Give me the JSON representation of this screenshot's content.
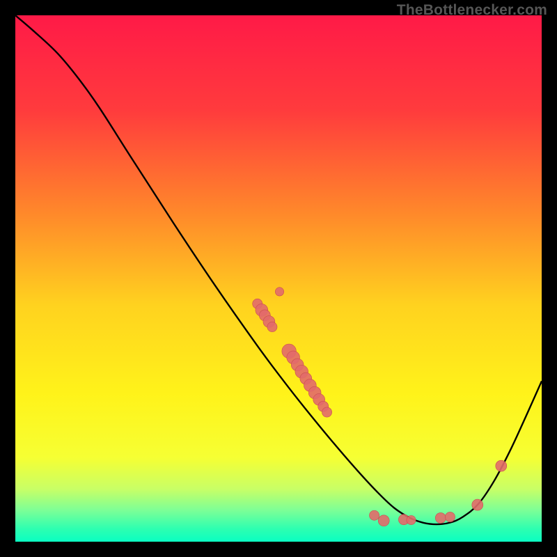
{
  "attribution": "TheBottlenecker.com",
  "colors": {
    "gradient_stops": [
      {
        "offset": 0.0,
        "color": "#ff1a47"
      },
      {
        "offset": 0.18,
        "color": "#ff3b3d"
      },
      {
        "offset": 0.38,
        "color": "#ff8a2a"
      },
      {
        "offset": 0.55,
        "color": "#ffd21f"
      },
      {
        "offset": 0.72,
        "color": "#fff31a"
      },
      {
        "offset": 0.84,
        "color": "#f6ff33"
      },
      {
        "offset": 0.9,
        "color": "#c8ff66"
      },
      {
        "offset": 0.94,
        "color": "#7dff96"
      },
      {
        "offset": 0.975,
        "color": "#2effb0"
      },
      {
        "offset": 1.0,
        "color": "#0affc2"
      }
    ],
    "curve": "#000000",
    "dot_fill": "#e26a6a",
    "dot_stroke": "#c94f4f"
  },
  "chart_data": {
    "type": "line",
    "title": "",
    "xlabel": "",
    "ylabel": "",
    "xlim": [
      0,
      100
    ],
    "ylim": [
      0,
      100
    ],
    "curve": [
      {
        "x": 0.0,
        "y": 100.0
      },
      {
        "x": 3.5,
        "y": 97.0
      },
      {
        "x": 8.0,
        "y": 92.8
      },
      {
        "x": 12.0,
        "y": 88.0
      },
      {
        "x": 16.0,
        "y": 82.4
      },
      {
        "x": 22.0,
        "y": 73.0
      },
      {
        "x": 30.0,
        "y": 60.6
      },
      {
        "x": 38.0,
        "y": 48.6
      },
      {
        "x": 46.0,
        "y": 37.2
      },
      {
        "x": 51.0,
        "y": 30.5
      },
      {
        "x": 55.0,
        "y": 25.4
      },
      {
        "x": 60.0,
        "y": 19.3
      },
      {
        "x": 65.0,
        "y": 13.5
      },
      {
        "x": 69.0,
        "y": 9.2
      },
      {
        "x": 72.0,
        "y": 6.4
      },
      {
        "x": 75.0,
        "y": 4.5
      },
      {
        "x": 77.5,
        "y": 3.6
      },
      {
        "x": 80.0,
        "y": 3.3
      },
      {
        "x": 82.5,
        "y": 3.6
      },
      {
        "x": 85.0,
        "y": 4.7
      },
      {
        "x": 88.0,
        "y": 7.2
      },
      {
        "x": 91.0,
        "y": 11.6
      },
      {
        "x": 94.0,
        "y": 17.3
      },
      {
        "x": 97.0,
        "y": 23.8
      },
      {
        "x": 100.0,
        "y": 30.5
      }
    ],
    "scatter": [
      {
        "x": 46.0,
        "y": 45.2,
        "r": 0.9
      },
      {
        "x": 46.8,
        "y": 44.0,
        "r": 1.3
      },
      {
        "x": 47.4,
        "y": 43.0,
        "r": 1.1
      },
      {
        "x": 48.2,
        "y": 41.8,
        "r": 1.2
      },
      {
        "x": 48.8,
        "y": 40.8,
        "r": 0.9
      },
      {
        "x": 50.2,
        "y": 47.5,
        "r": 0.7
      },
      {
        "x": 52.0,
        "y": 36.2,
        "r": 1.6
      },
      {
        "x": 52.8,
        "y": 35.0,
        "r": 1.4
      },
      {
        "x": 53.6,
        "y": 33.6,
        "r": 1.3
      },
      {
        "x": 54.4,
        "y": 32.3,
        "r": 1.4
      },
      {
        "x": 55.2,
        "y": 31.0,
        "r": 1.2
      },
      {
        "x": 56.0,
        "y": 29.7,
        "r": 1.3
      },
      {
        "x": 56.9,
        "y": 28.3,
        "r": 1.3
      },
      {
        "x": 57.7,
        "y": 27.0,
        "r": 1.2
      },
      {
        "x": 58.5,
        "y": 25.7,
        "r": 1.0
      },
      {
        "x": 59.2,
        "y": 24.6,
        "r": 0.9
      },
      {
        "x": 68.2,
        "y": 5.0,
        "r": 0.9
      },
      {
        "x": 70.0,
        "y": 4.0,
        "r": 1.1
      },
      {
        "x": 73.8,
        "y": 4.2,
        "r": 1.0
      },
      {
        "x": 75.2,
        "y": 4.1,
        "r": 0.8
      },
      {
        "x": 80.8,
        "y": 4.5,
        "r": 1.0
      },
      {
        "x": 82.6,
        "y": 4.7,
        "r": 0.9
      },
      {
        "x": 87.8,
        "y": 7.0,
        "r": 1.1
      },
      {
        "x": 92.3,
        "y": 14.4,
        "r": 1.1
      }
    ]
  }
}
